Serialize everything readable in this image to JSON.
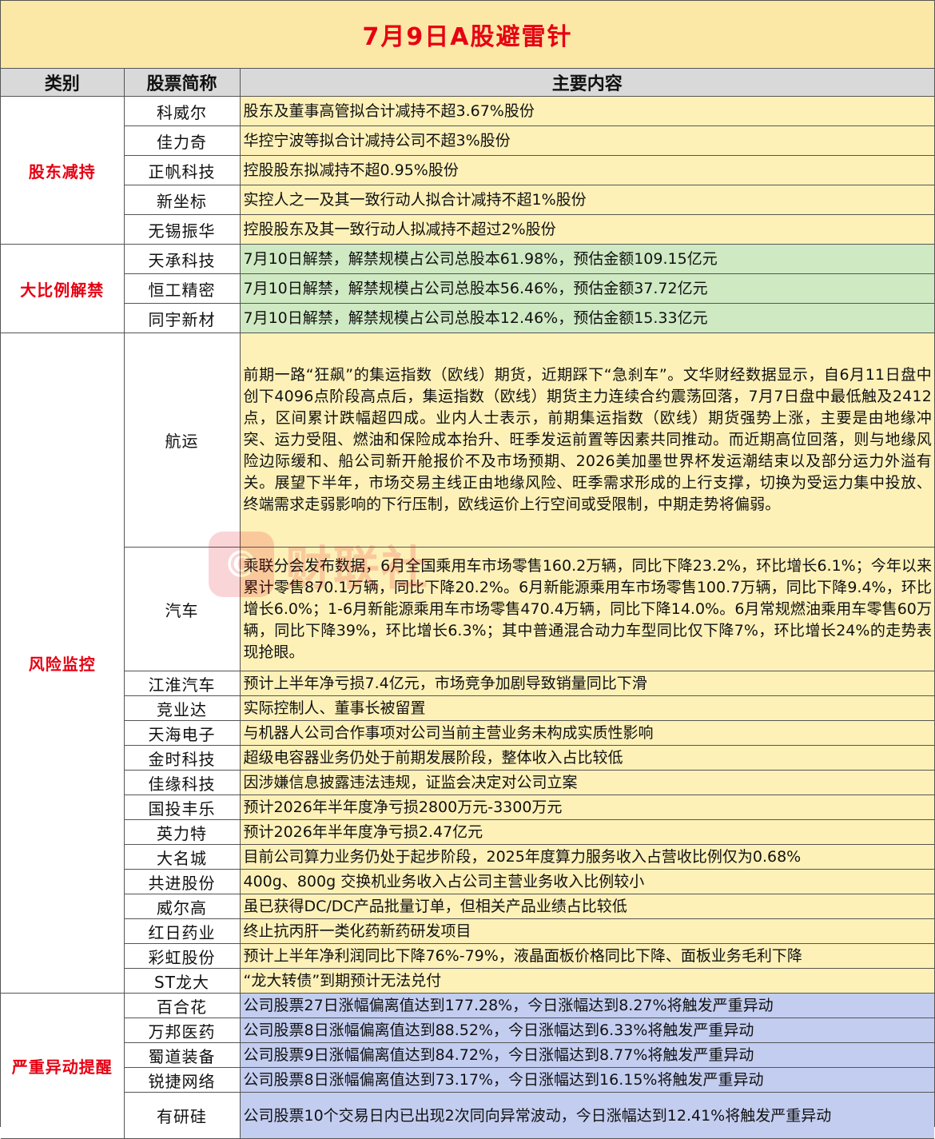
{
  "title": "7月9日A股避雷针",
  "headers": {
    "category": "类别",
    "name": "股票简称",
    "content": "主要内容"
  },
  "watermark": {
    "logo": "©",
    "text": "财联社"
  },
  "colors": {
    "title_bg": "#fbe7a6",
    "title_text": "#e60012",
    "header_bg": "#d9d9d9",
    "yellow": "#fdf1b8",
    "green": "#cfe9c3",
    "blue": "#c3cdf0"
  },
  "sections": [
    {
      "category": "股东减持",
      "rows": [
        {
          "name": "科威尔",
          "content": "股东及董事高管拟合计减持不超3.67%股份"
        },
        {
          "name": "佳力奇",
          "content": "华控宁波等拟合计减持公司不超3%股份"
        },
        {
          "name": "正帆科技",
          "content": "控股股东拟减持不超0.95%股份"
        },
        {
          "name": "新坐标",
          "content": "实控人之一及其一致行动人拟合计减持不超1%股份"
        },
        {
          "name": "无锡振华",
          "content": "控股股东及其一致行动人拟减持不超过2%股份"
        }
      ]
    },
    {
      "category": "大比例解禁",
      "rows": [
        {
          "name": "天承科技",
          "content": "7月10日解禁，解禁规模占公司总股本61.98%，预估金额109.15亿元"
        },
        {
          "name": "恒工精密",
          "content": "7月10日解禁，解禁规模占公司总股本56.46%，预估金额37.72亿元"
        },
        {
          "name": "同宇新材",
          "content": "7月10日解禁，解禁规模占公司总股本12.46%，预估金额15.33亿元"
        }
      ]
    },
    {
      "category": "风险监控",
      "rows": [
        {
          "name": "航运",
          "content": "前期一路“狂飙”的集运指数（欧线）期货，近期踩下“急刹车”。文华财经数据显示，自6月11日盘中创下4096点阶段高点后，集运指数（欧线）期货主力连续合约震荡回落，7月7日盘中最低触及2412点，区间累计跌幅超四成。业内人士表示，前期集运指数（欧线）期货强势上涨，主要是由地缘冲突、运力受阻、燃油和保险成本抬升、旺季发运前置等因素共同推动。而近期高位回落，则与地缘风险边际缓和、船公司新开舱报价不及市场预期、2026美加墨世界杯发运潮结束以及部分运力外溢有关。展望下半年，市场交易主线正由地缘风险、旺季需求形成的上行支撑，切换为受运力集中投放、终端需求走弱影响的下行压制，欧线运价上行空间或受限制，中期走势将偏弱。"
        },
        {
          "name": "汽车",
          "content": "乘联分会发布数据，6月全国乘用车市场零售160.2万辆，同比下降23.2%，环比增长6.1%；今年以来累计零售870.1万辆，同比下降20.2%。6月新能源乘用车市场零售100.7万辆，同比下降9.4%，环比增长6.0%；1-6月新能源乘用车市场零售470.4万辆，同比下降14.0%。6月常规燃油乘用车零售60万辆，同比下降39%，环比增长6.3%；其中普通混合动力车型同比仅下降7%，环比增长24%的走势表现抢眼。"
        },
        {
          "name": "江淮汽车",
          "content": "预计上半年净亏损7.4亿元，市场竞争加剧导致销量同比下滑"
        },
        {
          "name": "竞业达",
          "content": "实际控制人、董事长被留置"
        },
        {
          "name": "天海电子",
          "content": "与机器人公司合作事项对公司当前主营业务未构成实质性影响"
        },
        {
          "name": "金时科技",
          "content": "超级电容器业务仍处于前期发展阶段，整体收入占比较低"
        },
        {
          "name": "佳缘科技",
          "content": "因涉嫌信息披露违法违规，证监会决定对公司立案"
        },
        {
          "name": "国投丰乐",
          "content": "预计2026年半年度净亏损2800万元-3300万元"
        },
        {
          "name": "英力特",
          "content": "预计2026年半年度净亏损2.47亿元"
        },
        {
          "name": "大名城",
          "content": "目前公司算力业务仍处于起步阶段，2025年度算力服务收入占营收比例仅为0.68%"
        },
        {
          "name": "共进股份",
          "content": "400g、800g 交换机业务收入占公司主营业务收入比例较小"
        },
        {
          "name": "威尔高",
          "content": "虽已获得DC/DC产品批量订单，但相关产品业绩占比较低"
        },
        {
          "name": "红日药业",
          "content": "终止抗丙肝一类化药新药研发项目"
        },
        {
          "name": "彩虹股份",
          "content": "预计上半年净利润同比下降76%-79%，液晶面板价格同比下降、面板业务毛利下降"
        },
        {
          "name": "ST龙大",
          "content": "“龙大转债”到期预计无法兑付"
        }
      ]
    },
    {
      "category": "严重异动提醒",
      "rows": [
        {
          "name": "百合花",
          "content": "公司股票27日涨幅偏离值达到177.28%，今日涨幅达到8.27%将触发严重异动"
        },
        {
          "name": "万邦医药",
          "content": "公司股票8日涨幅偏离值达到88.52%，今日涨幅达到6.33%将触发严重异动"
        },
        {
          "name": "蜀道装备",
          "content": "公司股票9日涨幅偏离值达到84.72%，今日涨幅达到8.77%将触发严重异动"
        },
        {
          "name": "锐捷网络",
          "content": "公司股票8日涨幅偏离值达到73.17%，今日涨幅达到16.15%将触发严重异动"
        },
        {
          "name": "有研硅",
          "content": "公司股票10个交易日内已出现2次同向异常波动，今日涨幅达到12.41%将触发严重异动"
        }
      ]
    }
  ]
}
